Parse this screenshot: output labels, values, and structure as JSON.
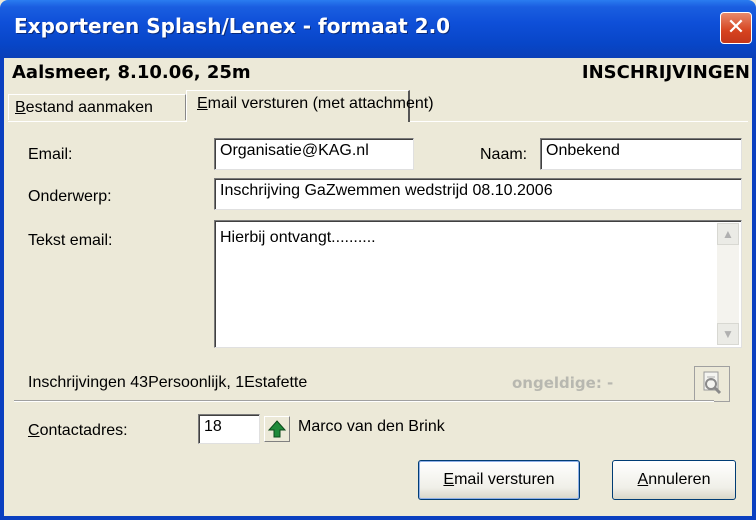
{
  "window": {
    "title": "Exporteren Splash/Lenex - formaat 2.0",
    "close_glyph": "✕",
    "accent_color": "#0a3fc0",
    "close_color": "#d6431f"
  },
  "header": {
    "meet": "Aalsmeer, 8.10.06, 25m",
    "section": "INSCHRIJVINGEN"
  },
  "tabs": [
    {
      "label_hotkey": "B",
      "label_rest": "estand aanmaken",
      "active": false
    },
    {
      "label_hotkey": "E",
      "label_rest": "mail versturen (met attachment)",
      "active": true
    }
  ],
  "form": {
    "email_label": "Email:",
    "email_value": "Organisatie@KAG.nl",
    "naam_label": "Naam:",
    "naam_value": "Onbekend",
    "onderwerp_label": "Onderwerp:",
    "onderwerp_value": "Inschrijving GaZwemmen wedstrijd 08.10.2006",
    "tekst_label": "Tekst email:",
    "tekst_value": "Hierbij ontvangt..........",
    "scroll_up_glyph": "▲",
    "scroll_down_glyph": "▼"
  },
  "summary": {
    "inschrijvingen": "Inschrijvingen 43Persoonlijk, 1Estafette",
    "ongeldige": "ongeldige: -",
    "view_icon": "magnifier-document-icon"
  },
  "contact": {
    "label_hotkey": "C",
    "label_rest": "ontactadres:",
    "number": "18",
    "name": "Marco van den Brink",
    "step_icon": "green-up-arrow-icon"
  },
  "buttons": {
    "send_hotkey": "E",
    "send_rest": "mail versturen",
    "cancel_hotkey": "A",
    "cancel_rest": "nnuleren"
  }
}
